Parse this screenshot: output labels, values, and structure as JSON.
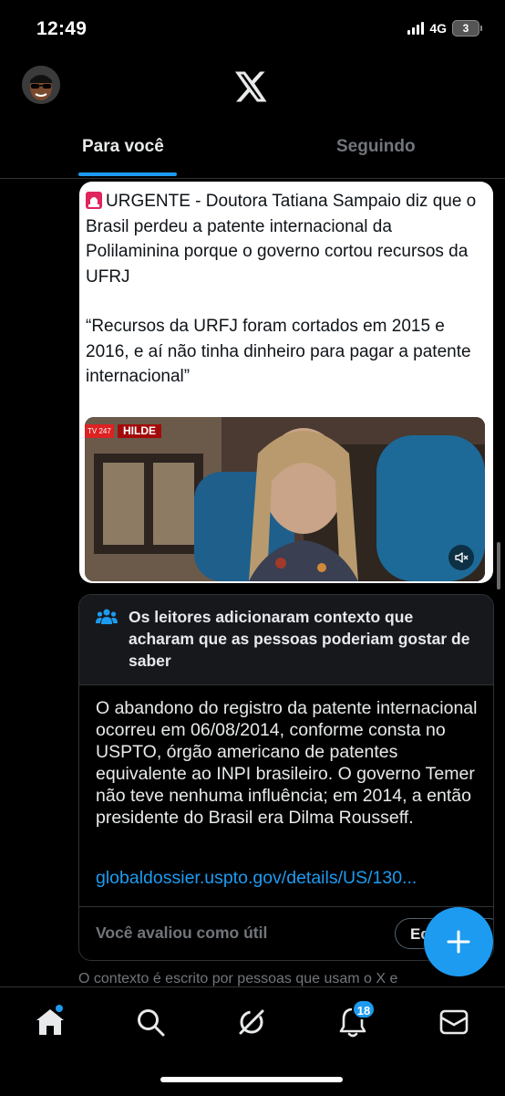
{
  "status_bar": {
    "time": "12:49",
    "network": "4G",
    "battery": "3"
  },
  "header": {
    "logo": "x-logo",
    "avatar": "user-avatar"
  },
  "tabs": [
    {
      "label": "Para você",
      "active": true
    },
    {
      "label": "Seguindo",
      "active": false
    }
  ],
  "post": {
    "headline": "URGENTE - Doutora Tatiana Sampaio diz que o Brasil perdeu a patente internacional da Polilaminina porque o governo cortou recursos da UFRJ",
    "quote": "“Recursos da URFJ foram cortados em 2015 e 2016, e aí não tinha dinheiro para pagar a patente internacional”",
    "video": {
      "channel_badge": "TV 247",
      "name_badge": "HILDE",
      "muted": true
    }
  },
  "community_note": {
    "title": "Os leitores adicionaram contexto que acharam que as pessoas poderiam gostar de saber",
    "body": "O abandono do registro da patente internacional ocorreu em 06/08/2014, conforme consta no USPTO, órgão americano de patentes equivalente ao INPI brasileiro. O governo Temer não teve nenhuma influência; em 2014, a então presidente do Brasil era Dilma Rousseff.",
    "link": "globaldossier.uspto.gov/details/US/130...",
    "rated_label": "Você avaliou como útil",
    "edit_label": "Editar"
  },
  "context_footer": "O contexto é escrito por pessoas que usam o X e",
  "bottom_nav": {
    "items": [
      "home",
      "search",
      "grok",
      "notifications",
      "messages"
    ],
    "notifications_count": "18"
  },
  "colors": {
    "accent": "#1d9bf0",
    "background": "#000000",
    "muted_text": "#71767b",
    "border": "#2f3336"
  }
}
